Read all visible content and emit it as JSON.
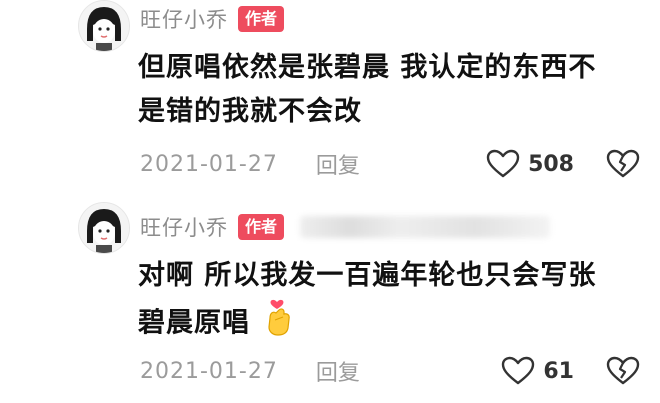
{
  "comments": [
    {
      "username": "旺仔小乔",
      "badge": "作者",
      "lines": [
        "但原唱依然是张碧晨 我认定的东西不",
        "是错的我就不会改"
      ],
      "date": "2021-01-27",
      "reply_label": "回复",
      "likes": "508",
      "emoji": ""
    },
    {
      "username": "旺仔小乔",
      "badge": "作者",
      "lines": [
        "对啊 所以我发一百遍年轮也只会写张",
        "碧晨原唱"
      ],
      "date": "2021-01-27",
      "reply_label": "回复",
      "likes": "61",
      "emoji": "finger-heart-emoji"
    }
  ],
  "colors": {
    "badge_bg": "#ee4c5e",
    "meta_text": "#9b9b9b",
    "username_text": "#8c8c8c"
  },
  "icons": {
    "like": "heart-outline-icon",
    "dislike": "broken-heart-icon"
  }
}
